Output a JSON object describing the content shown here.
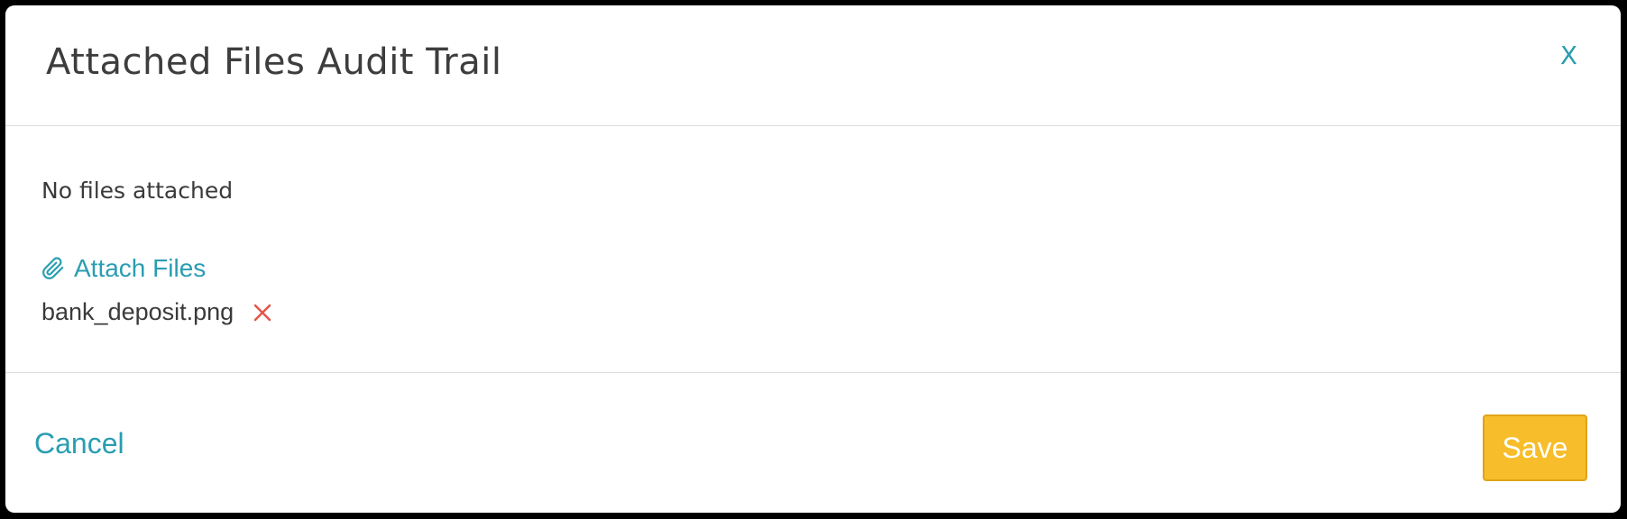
{
  "dialog": {
    "title": "Attached Files Audit Trail",
    "close_label": "X"
  },
  "body": {
    "empty_message": "No files attached",
    "attach_label": "Attach Files",
    "files": [
      {
        "name": "bank_deposit.png"
      }
    ]
  },
  "footer": {
    "cancel_label": "Cancel",
    "save_label": "Save"
  },
  "icons": {
    "attach": "paperclip-icon",
    "remove": "remove-x-icon"
  },
  "colors": {
    "accent": "#2a9db1",
    "save_button": "#f7bd2a",
    "remove": "#e2574c",
    "text": "#3a3a3a"
  }
}
